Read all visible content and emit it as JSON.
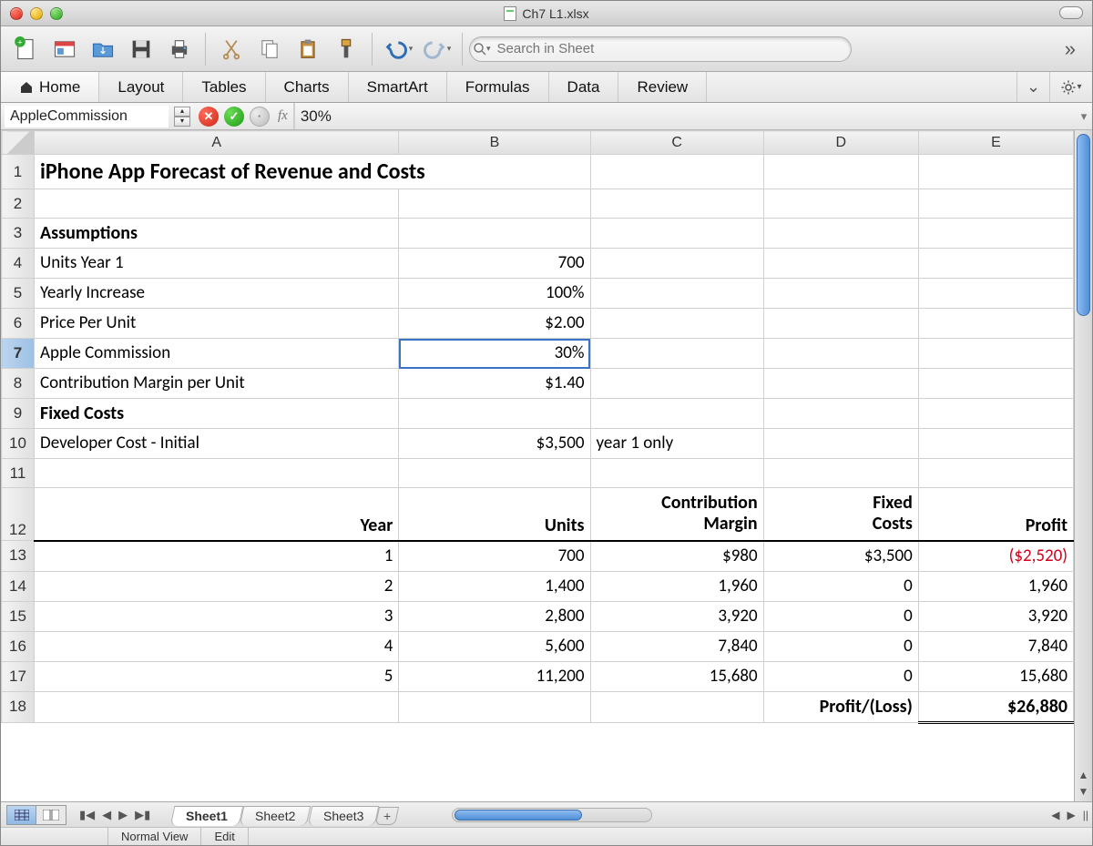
{
  "window": {
    "filename": "Ch7 L1.xlsx"
  },
  "toolbar": {
    "search_placeholder": "Search in Sheet"
  },
  "ribbon": {
    "tabs": [
      "Home",
      "Layout",
      "Tables",
      "Charts",
      "SmartArt",
      "Formulas",
      "Data",
      "Review"
    ]
  },
  "formula_bar": {
    "name_box": "AppleCommission",
    "fx_label": "fx",
    "value": "30%"
  },
  "columns": [
    "A",
    "B",
    "C",
    "D",
    "E"
  ],
  "rows": {
    "r1": {
      "A": "iPhone App Forecast of Revenue and Costs"
    },
    "r2": {},
    "r3": {
      "A": "Assumptions"
    },
    "r4": {
      "A": "Units Year 1",
      "B": "700"
    },
    "r5": {
      "A": "Yearly Increase",
      "B": "100%"
    },
    "r6": {
      "A": "Price Per Unit",
      "B": "$2.00"
    },
    "r7": {
      "A": "Apple Commission",
      "B": "30%"
    },
    "r8": {
      "A": "Contribution Margin per Unit",
      "B": "$1.40"
    },
    "r9": {
      "A": "Fixed  Costs"
    },
    "r10": {
      "A": "Developer Cost - Initial",
      "B": "$3,500",
      "C": "year 1 only"
    },
    "r11": {},
    "r12": {
      "A": "Year",
      "B": "Units",
      "C": "Contribution Margin",
      "C_top": "Contribution",
      "C_bot": "Margin",
      "D_top": "Fixed",
      "D_bot": "Costs",
      "D": "Fixed Costs",
      "E": "Profit"
    },
    "r13": {
      "A": "1",
      "B": "700",
      "C": "$980",
      "D": "$3,500",
      "E": "($2,520)"
    },
    "r14": {
      "A": "2",
      "B": "1,400",
      "C": "1,960",
      "D": "0",
      "E": "1,960"
    },
    "r15": {
      "A": "3",
      "B": "2,800",
      "C": "3,920",
      "D": "0",
      "E": "3,920"
    },
    "r16": {
      "A": "4",
      "B": "5,600",
      "C": "7,840",
      "D": "0",
      "E": "7,840"
    },
    "r17": {
      "A": "5",
      "B": "11,200",
      "C": "15,680",
      "D": "0",
      "E": "15,680"
    },
    "r18": {
      "D": "Profit/(Loss)",
      "E": "$26,880"
    }
  },
  "row_numbers": [
    "1",
    "2",
    "3",
    "4",
    "5",
    "6",
    "7",
    "8",
    "9",
    "10",
    "11",
    "12",
    "13",
    "14",
    "15",
    "16",
    "17",
    "18"
  ],
  "sheet_tabs": [
    "Sheet1",
    "Sheet2",
    "Sheet3"
  ],
  "status": {
    "view": "Normal View",
    "mode": "Edit"
  },
  "chart_data": {
    "type": "table",
    "title": "iPhone App Forecast of Revenue and Costs",
    "assumptions": {
      "units_year_1": 700,
      "yearly_increase_pct": 100,
      "price_per_unit": 2.0,
      "apple_commission_pct": 30,
      "contribution_margin_per_unit": 1.4
    },
    "fixed_costs": {
      "developer_cost_initial": 3500,
      "note": "year 1 only"
    },
    "columns": [
      "Year",
      "Units",
      "Contribution Margin",
      "Fixed Costs",
      "Profit"
    ],
    "rows": [
      {
        "year": 1,
        "units": 700,
        "contribution_margin": 980,
        "fixed_costs": 3500,
        "profit": -2520
      },
      {
        "year": 2,
        "units": 1400,
        "contribution_margin": 1960,
        "fixed_costs": 0,
        "profit": 1960
      },
      {
        "year": 3,
        "units": 2800,
        "contribution_margin": 3920,
        "fixed_costs": 0,
        "profit": 3920
      },
      {
        "year": 4,
        "units": 5600,
        "contribution_margin": 7840,
        "fixed_costs": 0,
        "profit": 7840
      },
      {
        "year": 5,
        "units": 11200,
        "contribution_margin": 15680,
        "fixed_costs": 0,
        "profit": 15680
      }
    ],
    "total_profit": 26880
  }
}
